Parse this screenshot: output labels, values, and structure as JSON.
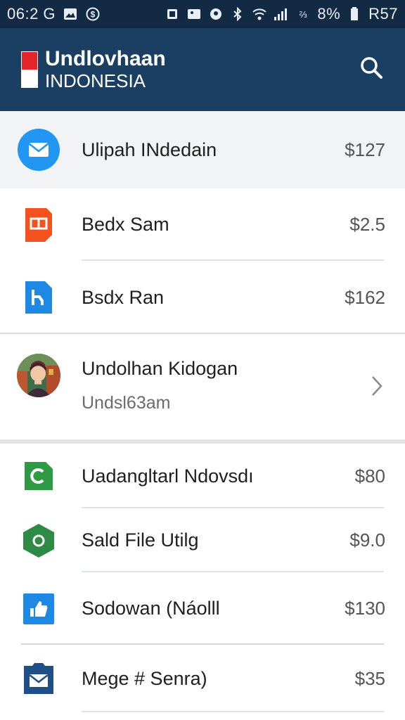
{
  "status_bar": {
    "time": "06:2 G",
    "battery": "8%",
    "right_text": "R57"
  },
  "app_bar": {
    "title_line1": "Undlovhaan",
    "title_line2": "INDONESIA"
  },
  "items": [
    {
      "label": "Ulipah INdedain",
      "amount": "$127",
      "icon": "mail-circle-icon",
      "color": "#2196f3"
    },
    {
      "label": "Bedx Sam",
      "amount": "$2.5",
      "icon": "orange-doc-icon",
      "color": "#f4511e"
    },
    {
      "label": "Bsdx Ran",
      "amount": "$162",
      "icon": "blue-file-icon",
      "color": "#1e88e5"
    },
    {
      "label": "Undolhan Kidogan",
      "sublabel": "Undsl63am",
      "icon": "avatar"
    },
    {
      "label": "Uadangltarl Ndovsdı",
      "amount": "$80",
      "icon": "green-doc-icon",
      "color": "#2e9b44"
    },
    {
      "label": "Sald File Utilg",
      "amount": "$9.0",
      "icon": "green-hex-icon",
      "color": "#2e8b46"
    },
    {
      "label": "Sodowan (Náolll",
      "amount": "$130",
      "icon": "thumb-up-icon",
      "color": "#1e88e5"
    },
    {
      "label": "Mege # Senra)",
      "amount": "$35",
      "icon": "envelope-icon",
      "color": "#1f4f85"
    }
  ]
}
